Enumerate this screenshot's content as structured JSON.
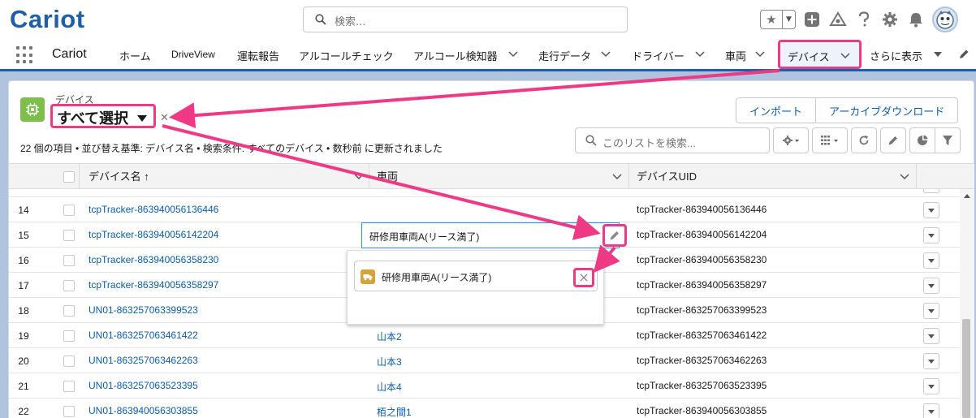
{
  "header": {
    "logo_text": "Cariot",
    "search_placeholder": "検索..."
  },
  "nav": {
    "app_name": "Cariot",
    "items": [
      {
        "label": "ホーム"
      },
      {
        "label": "DriveView"
      },
      {
        "label": "運転報告"
      },
      {
        "label": "アルコールチェック"
      },
      {
        "label": "アルコール検知器"
      },
      {
        "label": "走行データ"
      },
      {
        "label": "ドライバー"
      },
      {
        "label": "車両"
      },
      {
        "label": "デバイス"
      },
      {
        "label": "さらに表示"
      }
    ]
  },
  "list_view": {
    "object_label": "デバイス",
    "view_name": "すべて選択",
    "import_button": "インポート",
    "archive_button": "アーカイブダウンロード",
    "status_text": "22 個の項目 • 並び替え基準: デバイス名 • 検索条件: すべてのデバイス • 数秒前 に更新されました",
    "list_search_placeholder": "このリストを検索...",
    "columns": [
      {
        "label": "デバイス名 ↑"
      },
      {
        "label": "車両"
      },
      {
        "label": "デバイスUID"
      }
    ]
  },
  "rows": [
    {
      "num": "14",
      "name": "tcpTracker-863940056136446",
      "vehicle": "",
      "uid": "tcpTracker-863940056136446"
    },
    {
      "num": "15",
      "name": "tcpTracker-863940056142204",
      "vehicle": "",
      "uid": "tcpTracker-863940056142204"
    },
    {
      "num": "16",
      "name": "tcpTracker-863940056358230",
      "vehicle": "",
      "uid": "tcpTracker-863940056358230"
    },
    {
      "num": "17",
      "name": "tcpTracker-863940056358297",
      "vehicle": "",
      "uid": "tcpTracker-863940056358297"
    },
    {
      "num": "18",
      "name": "UN01-863257063399523",
      "vehicle": "",
      "uid": "tcpTracker-863257063399523"
    },
    {
      "num": "19",
      "name": "UN01-863257063461422",
      "vehicle": "山本2",
      "uid": "tcpTracker-863257063461422"
    },
    {
      "num": "20",
      "name": "UN01-863257063462263",
      "vehicle": "山本3",
      "uid": "tcpTracker-863257063462263"
    },
    {
      "num": "21",
      "name": "UN01-863257063523395",
      "vehicle": "山本4",
      "uid": "tcpTracker-863257063523395"
    },
    {
      "num": "22",
      "name": "UN01-863940056303855",
      "vehicle": "栢之間1",
      "uid": "tcpTracker-863940056303855"
    }
  ],
  "inline_edit": {
    "value": "研修用車両A(リース満了)",
    "lookup_pill": "研修用車両A(リース満了)"
  },
  "colors": {
    "brand_blue": "#1f5fa8",
    "link_blue": "#0b5cab",
    "highlight_pink": "#ee3a84",
    "band_blue": "#b0c4df",
    "device_icon_green": "#7dbf4a",
    "vehicle_icon_gold": "#d4a43b"
  }
}
